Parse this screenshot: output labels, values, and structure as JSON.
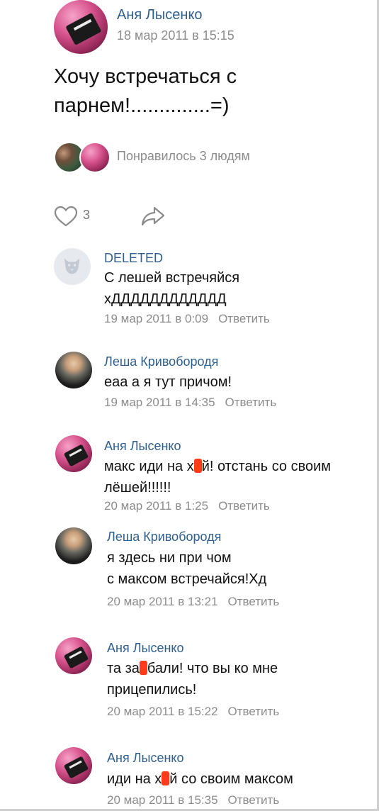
{
  "post": {
    "author": "Аня Лысенко",
    "time": "18 мар 2011 в 15:15",
    "text": "Хочу встречаться с парнем!..............=)",
    "likes_text": "Понравилось 3 людям",
    "like_count": "3"
  },
  "icons": {
    "heart": "heart-icon",
    "share": "share-icon",
    "deleted_avatar": "dog-avatar-icon"
  },
  "comments": [
    {
      "author": "DELETED",
      "text": "С лешей встречяйся хДДДДДДДДДДДД",
      "time": "19 мар 2011 в 0:09",
      "reply": "Ответить"
    },
    {
      "author": "Леша Кривобородя",
      "text": "еаа а я тут причом!",
      "time": "19 мар 2011 в 14:35",
      "reply": "Ответить"
    },
    {
      "author": "Аня Лысенко",
      "text_before": "макс иди на х",
      "text_after": "й! отстань со своим лёшей!!!!!!",
      "time": "20 мар 2011 в 1:25",
      "reply": "Ответить"
    },
    {
      "author": "Леша Кривобородя",
      "line1": "я здесь ни при чом",
      "line2": "с максом встречайся!Хд",
      "time": "20 мар 2011 в 13:21",
      "reply": "Ответить"
    },
    {
      "author": "Аня Лысенко",
      "text_before": "та за",
      "text_after": "бали! что вы ко мне прицепились!",
      "time": "20 мар 2011 в 15:22",
      "reply": "Ответить"
    },
    {
      "author": "Аня Лысенко",
      "text_before": "иди на х",
      "text_after": "й со своим максом",
      "time": "20 мар 2011 в 15:35",
      "reply": "Ответить"
    }
  ],
  "colors": {
    "author_link": "#2e5f8f",
    "meta_gray": "#8c8c8c",
    "redaction": "#ff3b1a"
  }
}
